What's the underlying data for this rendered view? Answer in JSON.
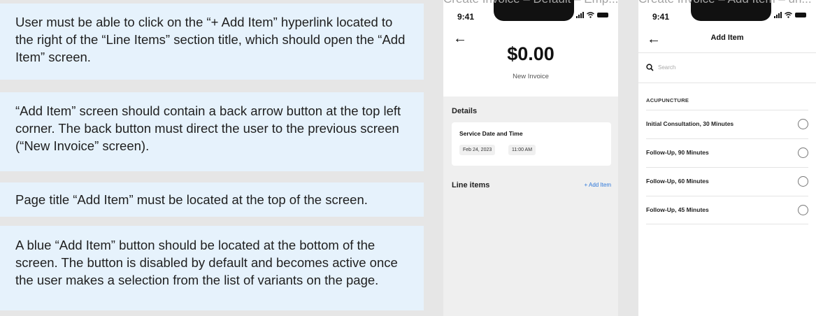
{
  "requirements": [
    "User must be able to click on the “+ Add Item” hyperlink located to the right of the “Line Items” section title, which should open the “Add Item” screen.",
    "“Add Item” screen should contain a back arrow button at the top left corner. The back button must direct the user to the previous screen (“New Invoice” screen).",
    "Page title “Add Item” must be located at the top of the screen.",
    "A blue “Add Item” button should be located at the bottom of the screen. The button is disabled by default and becomes active once the user makes a selection from the list of variants on the page."
  ],
  "frames": {
    "left_label": "Create Invoice – Default – Emp...",
    "right_label": "Create Invoice – Add Item – un..."
  },
  "status_bar": {
    "time": "9:41"
  },
  "new_invoice": {
    "amount": "$0.00",
    "subtitle": "New Invoice",
    "details_title": "Details",
    "service_label": "Service Date and Time",
    "date": "Feb 24, 2023",
    "time": "11:00 AM",
    "line_items_title": "Line items",
    "add_item_link": "+ Add Item"
  },
  "add_item": {
    "title": "Add Item",
    "search_placeholder": "Search",
    "category": "ACUPUNCTURE",
    "items": [
      {
        "label": "Initial Consultation, 30 Minutes",
        "selected": false
      },
      {
        "label": "Follow-Up, 90 Minutes",
        "selected": false
      },
      {
        "label": "Follow-Up, 60 Minutes",
        "selected": false
      },
      {
        "label": "Follow-Up, 45 Minutes",
        "selected": false
      }
    ]
  },
  "icons": {
    "back": "arrow-left-icon",
    "search": "search-icon",
    "signal": "signal-icon",
    "wifi": "wifi-icon",
    "battery": "battery-icon",
    "radio": "radio-unchecked-icon"
  },
  "colors": {
    "card_bg": "#e6f2fc",
    "link_blue": "#2b76d9",
    "canvas": "#e6e6e6"
  }
}
